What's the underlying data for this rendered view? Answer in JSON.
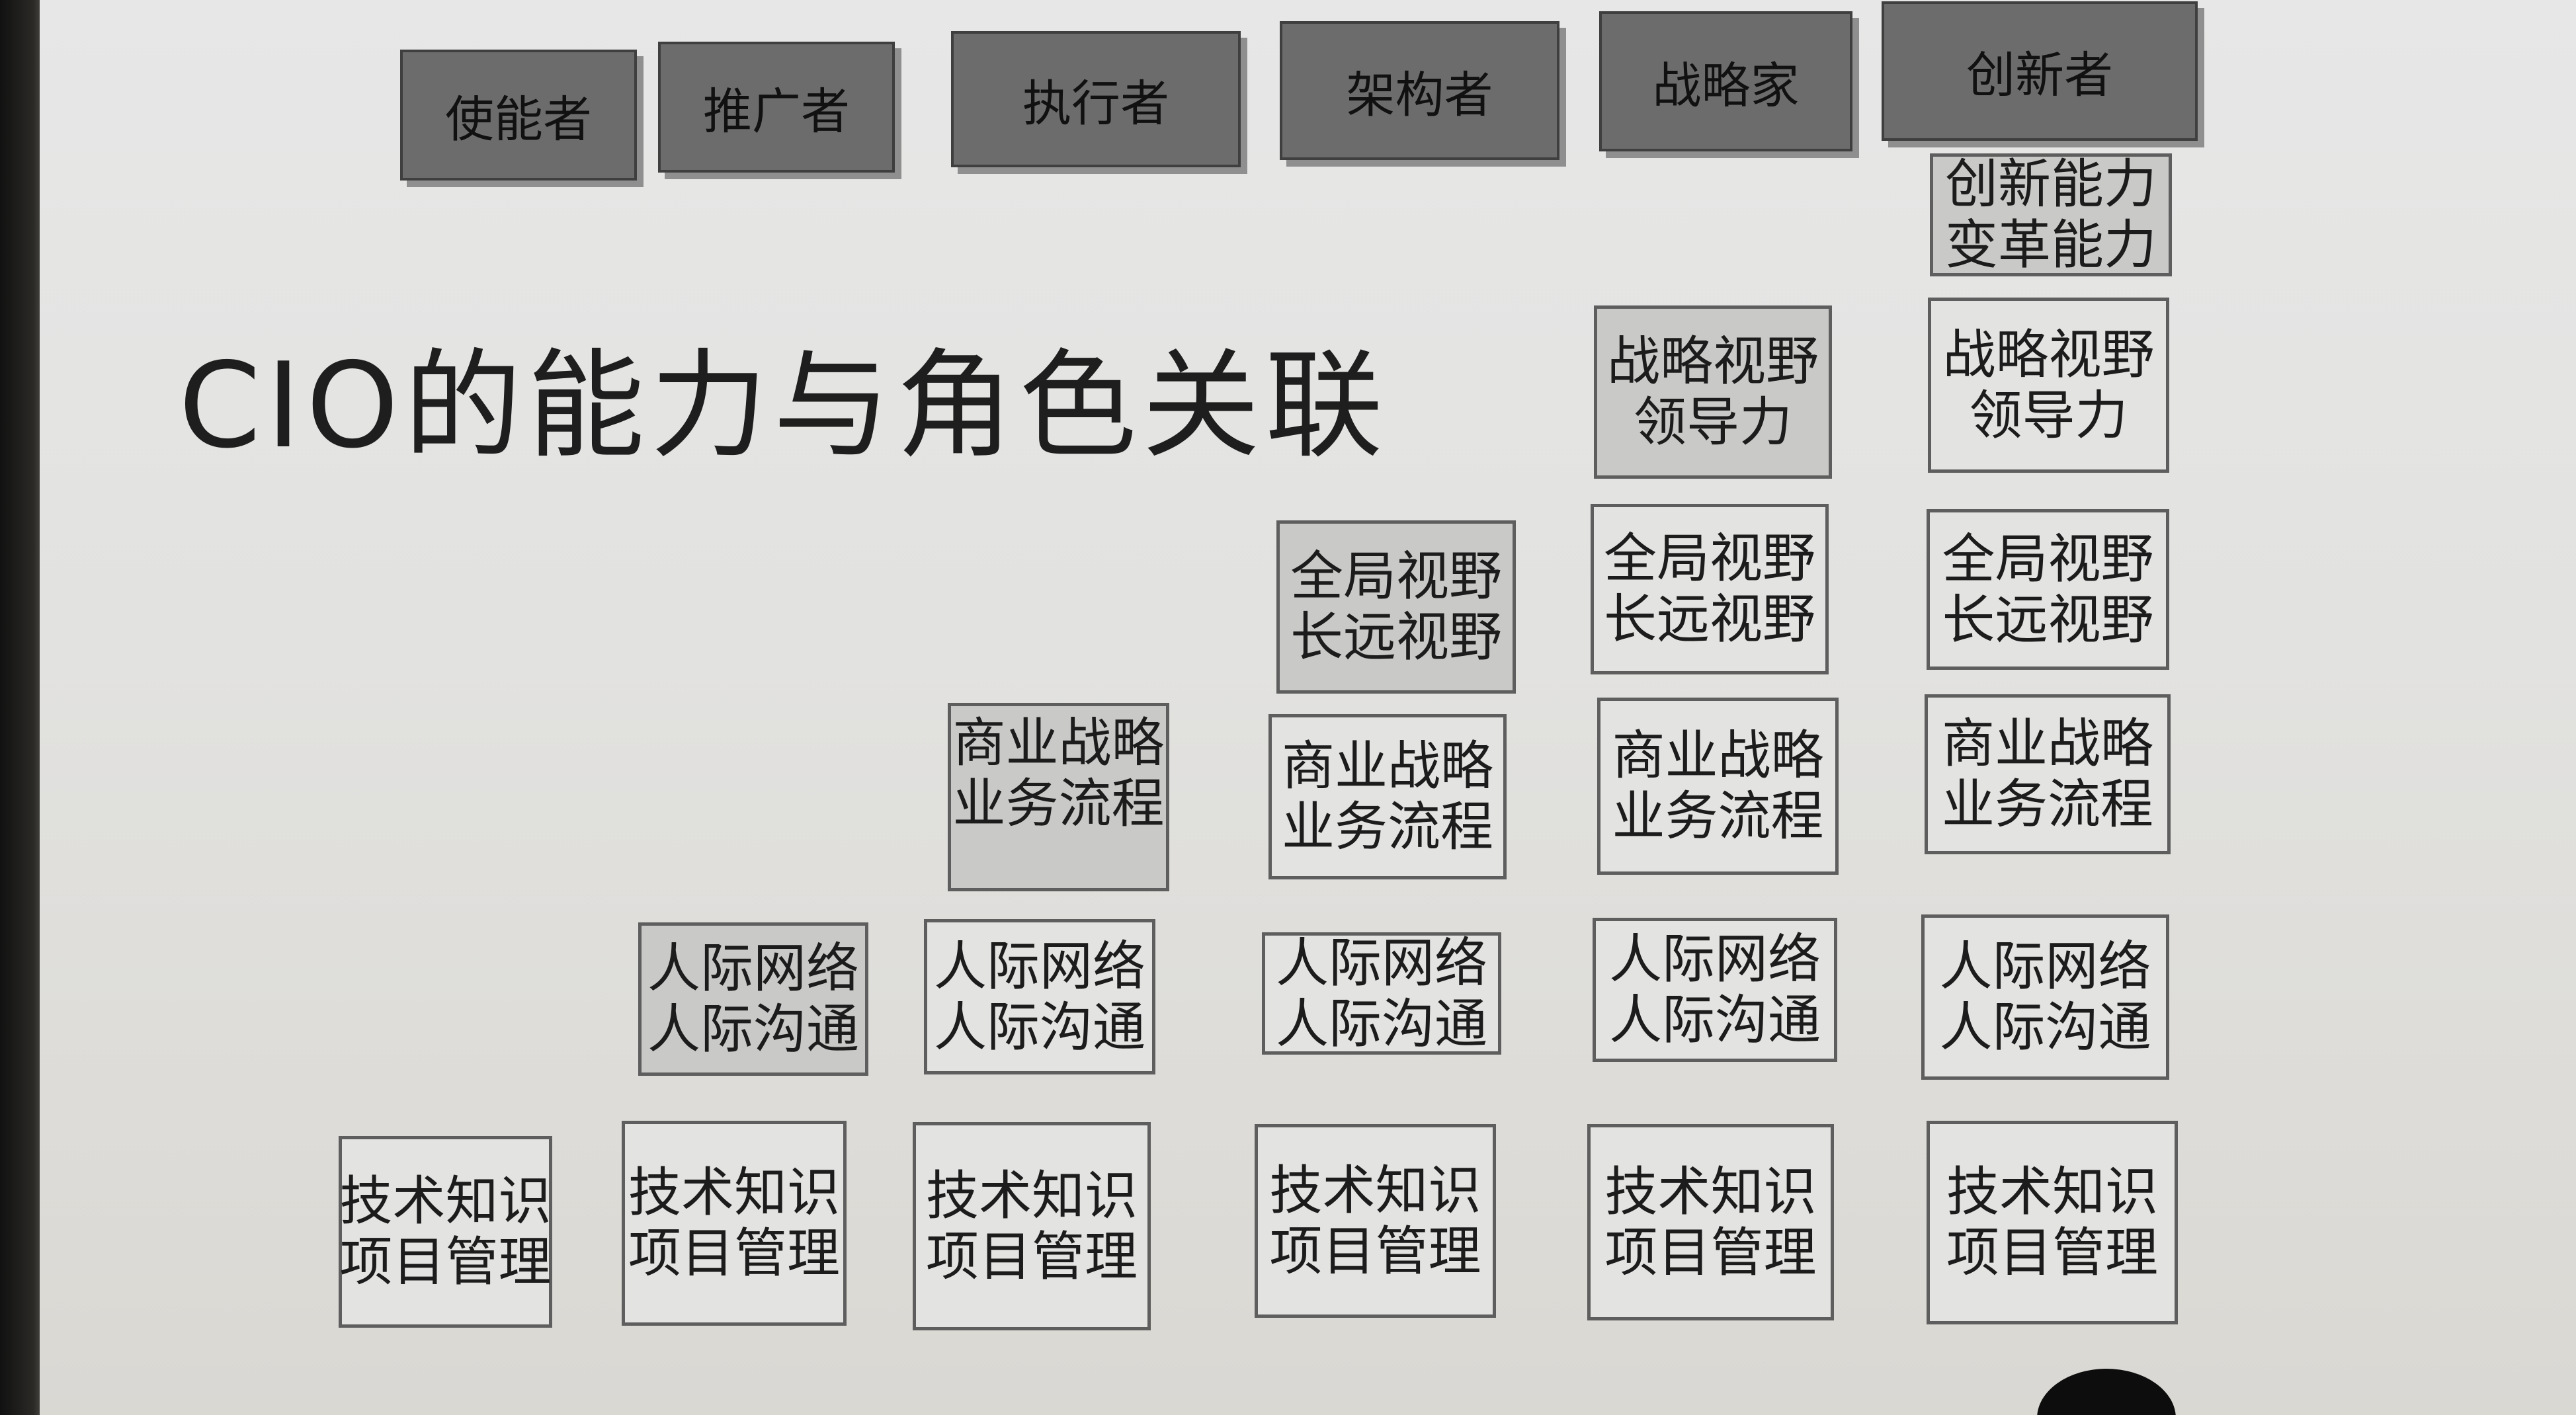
{
  "title": "CIO的能力与角色关联",
  "roles": [
    {
      "id": "enabler",
      "label": "使能者"
    },
    {
      "id": "promoter",
      "label": "推广者"
    },
    {
      "id": "executor",
      "label": "执行者"
    },
    {
      "id": "architect",
      "label": "架构者"
    },
    {
      "id": "strategist",
      "label": "战略家"
    },
    {
      "id": "innovator",
      "label": "创新者"
    }
  ],
  "capabilities": {
    "tech": [
      "技术知识",
      "项目管理"
    ],
    "people": [
      "人际网络",
      "人际沟通"
    ],
    "business": [
      "商业战略",
      "业务流程"
    ],
    "vision": [
      "全局视野",
      "长远视野"
    ],
    "strategy": [
      "战略视野",
      "领导力"
    ],
    "innovation": [
      "创新能力",
      "变革能力"
    ]
  },
  "colors": {
    "role_fill": "#6c6c6c",
    "box_border": "#5e5e5e",
    "box_fill_gray": "#c9c9c7",
    "box_fill_light": "#e3e3e1",
    "slide_bg": "#e4e4e2"
  }
}
